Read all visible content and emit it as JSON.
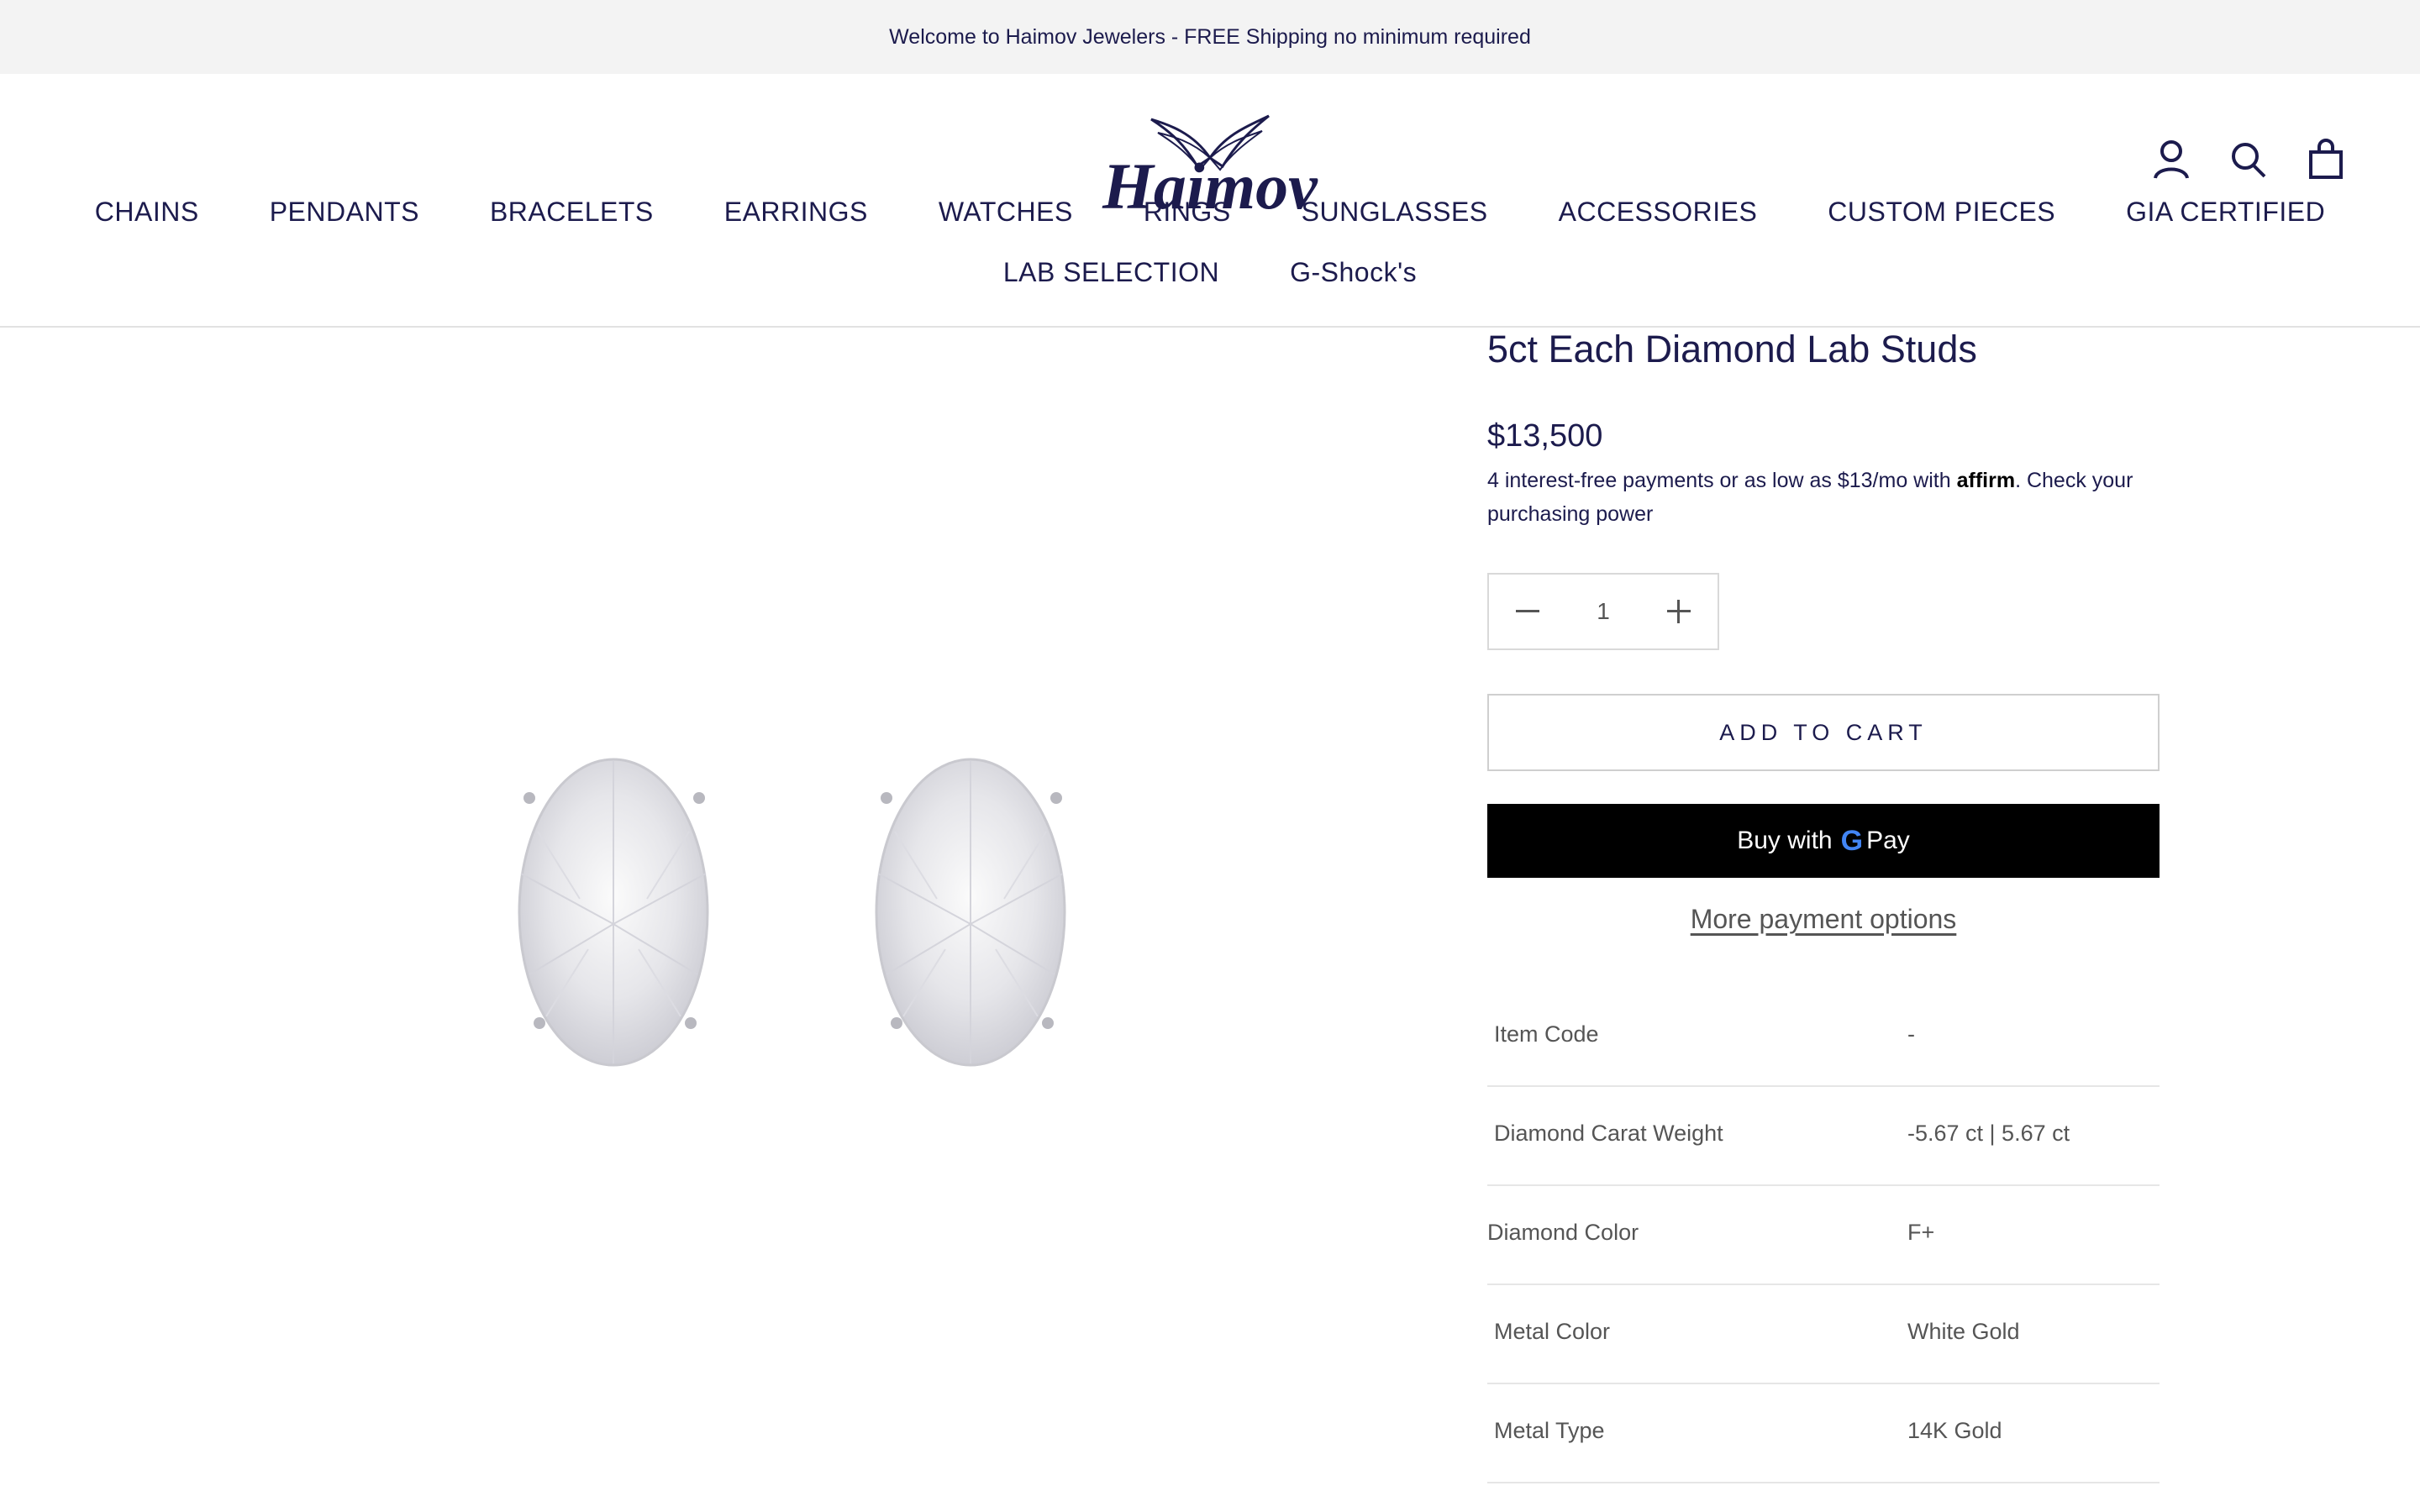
{
  "announcement": "Welcome to Haimov Jewelers - FREE Shipping no minimum required",
  "brand": {
    "logo_text": "Haimov"
  },
  "nav": {
    "row1": [
      "CHAINS",
      "PENDANTS",
      "BRACELETS",
      "EARRINGS",
      "WATCHES",
      "RINGS",
      "SUNGLASSES",
      "ACCESSORIES",
      "CUSTOM PIECES",
      "GIA CERTIFIED"
    ],
    "row2": [
      "LAB SELECTION",
      "G-Shock's"
    ]
  },
  "header_icons": [
    "account-icon",
    "search-icon",
    "cart-icon"
  ],
  "product": {
    "title": "5ct Each Diamond Lab Studs",
    "price": "$13,500",
    "affirm_prefix": "4 interest-free payments or as low as $13/mo with ",
    "affirm_brand": "affirm",
    "affirm_suffix": ". Check your purchasing power",
    "quantity": "1",
    "add_to_cart": "ADD TO CART",
    "gpay_prefix": "Buy with",
    "gpay_g": "G",
    "gpay_pay": "Pay",
    "more_payment": "More payment options"
  },
  "specs": [
    {
      "key": "Item Code",
      "value": "-"
    },
    {
      "key": "Diamond Carat Weight",
      "value": "-5.67 ct | 5.67 ct"
    },
    {
      "key": "Diamond Color",
      "value": "F+"
    },
    {
      "key": "Metal Color",
      "value": "White Gold"
    },
    {
      "key": "Metal Type",
      "value": "14K Gold"
    }
  ],
  "colors": {
    "brand_navy": "#1c1b4d",
    "announce_bg": "#f3f3f3",
    "gpay_bg": "#000000"
  }
}
